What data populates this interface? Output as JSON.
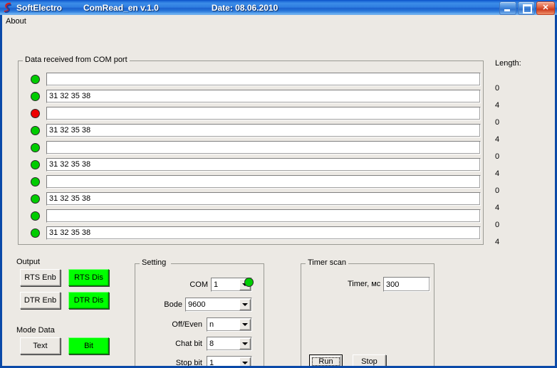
{
  "window": {
    "app_name": "SoftElectro",
    "program_title": "ComRead_en v.1.0",
    "date_label": "Date:  08.06.2010",
    "icon": "softelectro-logo-icon",
    "minimize_glyph": "minimize-icon",
    "maximize_glyph": "maximize-icon",
    "close_glyph": "✕",
    "bg_color": "#ece9e4",
    "titlebar_color": "#2e7de0"
  },
  "menu": {
    "items": [
      {
        "label": "About"
      }
    ]
  },
  "data_group": {
    "title": "Data received from COM port",
    "length_title": "Length:",
    "rows": [
      {
        "led": "green",
        "value": "",
        "length": "0"
      },
      {
        "led": "green",
        "value": "31 32 35 38",
        "length": "4"
      },
      {
        "led": "red",
        "value": "",
        "length": "0"
      },
      {
        "led": "green",
        "value": "31 32 35 38",
        "length": "4"
      },
      {
        "led": "green",
        "value": "",
        "length": "0"
      },
      {
        "led": "green",
        "value": "31 32 35 38",
        "length": "4"
      },
      {
        "led": "green",
        "value": "",
        "length": "0"
      },
      {
        "led": "green",
        "value": "31 32 35 38",
        "length": "4"
      },
      {
        "led": "green",
        "value": "",
        "length": "0"
      },
      {
        "led": "green",
        "value": "31 32 35 38",
        "length": "4"
      }
    ],
    "led_colors": {
      "green": "#00cc00",
      "red": "#ee0000"
    }
  },
  "output": {
    "title": "Output",
    "rts_enable": "RTS Enb",
    "rts_disable": "RTS Dis",
    "dtr_enable": "DTR Enb",
    "dtr_disable": "DTR Dis",
    "active_color": "#00ff00"
  },
  "mode_data": {
    "title": "Mode Data",
    "text_button": "Text",
    "bit_button": "Bit",
    "active": "Bit"
  },
  "setting": {
    "title": "Setting",
    "fields": [
      {
        "label": "COM",
        "value": "1"
      },
      {
        "label": "Bode",
        "value": "9600"
      },
      {
        "label": "Off/Even",
        "value": "n"
      },
      {
        "label": "Chat bit",
        "value": "8"
      },
      {
        "label": "Stop bit",
        "value": "1"
      }
    ],
    "status_led": "green"
  },
  "timer": {
    "title": "Timer scan",
    "label": "Timer, мс",
    "value": "300",
    "run_button": "Run",
    "stop_button": "Stop"
  }
}
